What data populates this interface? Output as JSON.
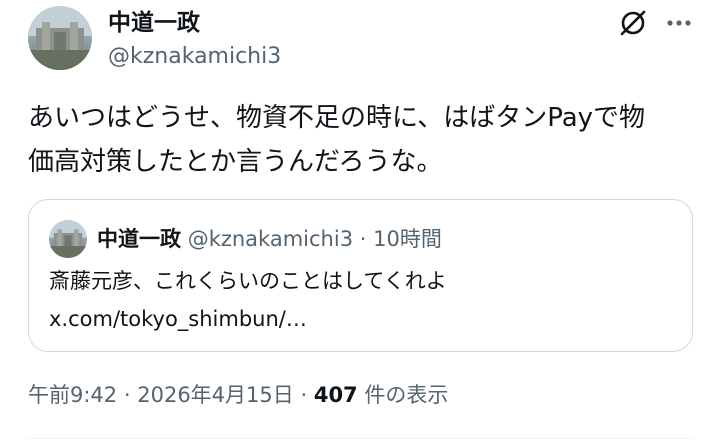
{
  "author": {
    "display_name": "中道一政",
    "handle": "@kznakamichi3"
  },
  "icons": {
    "grok": "grok-icon",
    "more": "more-icon"
  },
  "tweet": {
    "text_line1": "あいつはどうせ、物資不足の時に、はばタンPayで物",
    "text_line2": "価高対策したとか言うんだろうな。"
  },
  "quote": {
    "display_name": "中道一政",
    "handle": "@kznakamichi3",
    "separator": "·",
    "time": "10時間",
    "text": "斎藤元彦、これくらいのことはしてくれよ",
    "link": "x.com/tokyo_shimbun/…"
  },
  "meta": {
    "time": "午前9:42",
    "date": "2026年4月15日",
    "separator": "·",
    "views_count": "407",
    "views_label": "件の表示"
  },
  "colors": {
    "text": "#0f1419",
    "secondary": "#536471",
    "border": "#cfd9de"
  }
}
